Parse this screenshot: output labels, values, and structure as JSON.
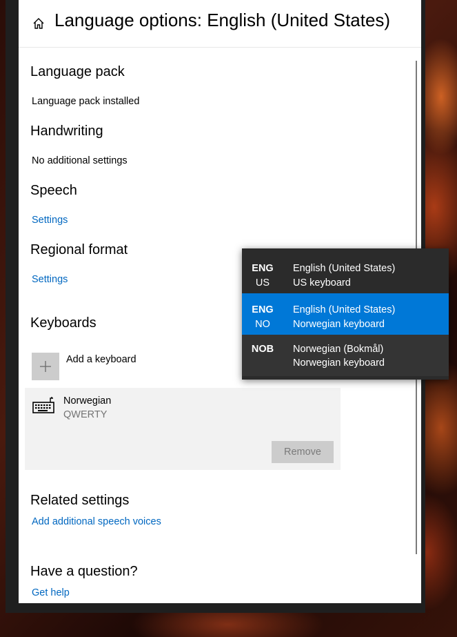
{
  "header": {
    "title": "Language options: English (United States)"
  },
  "language_pack": {
    "heading": "Language pack",
    "status": "Language pack installed"
  },
  "handwriting": {
    "heading": "Handwriting",
    "status": "No additional settings"
  },
  "speech": {
    "heading": "Speech",
    "link": "Settings"
  },
  "regional_format": {
    "heading": "Regional format",
    "link": "Settings"
  },
  "keyboards": {
    "heading": "Keyboards",
    "add_label": "Add a keyboard",
    "items": [
      {
        "name": "Norwegian",
        "layout": "QWERTY",
        "remove_label": "Remove"
      }
    ]
  },
  "related": {
    "heading": "Related settings",
    "link": "Add additional speech voices"
  },
  "question": {
    "heading": "Have a question?",
    "link": "Get help"
  },
  "input_switcher": {
    "items": [
      {
        "code": "ENG",
        "region": "US",
        "language": "English (United States)",
        "keyboard": "US keyboard",
        "state": "normal"
      },
      {
        "code": "ENG",
        "region": "NO",
        "language": "English (United States)",
        "keyboard": "Norwegian keyboard",
        "state": "selected"
      },
      {
        "code": "NOB",
        "region": "",
        "language": "Norwegian (Bokmål)",
        "keyboard": "Norwegian keyboard",
        "state": "hover"
      }
    ]
  },
  "colors": {
    "accent": "#0078d7",
    "link": "#0067c0",
    "flyout_bg": "#2b2b2b"
  }
}
